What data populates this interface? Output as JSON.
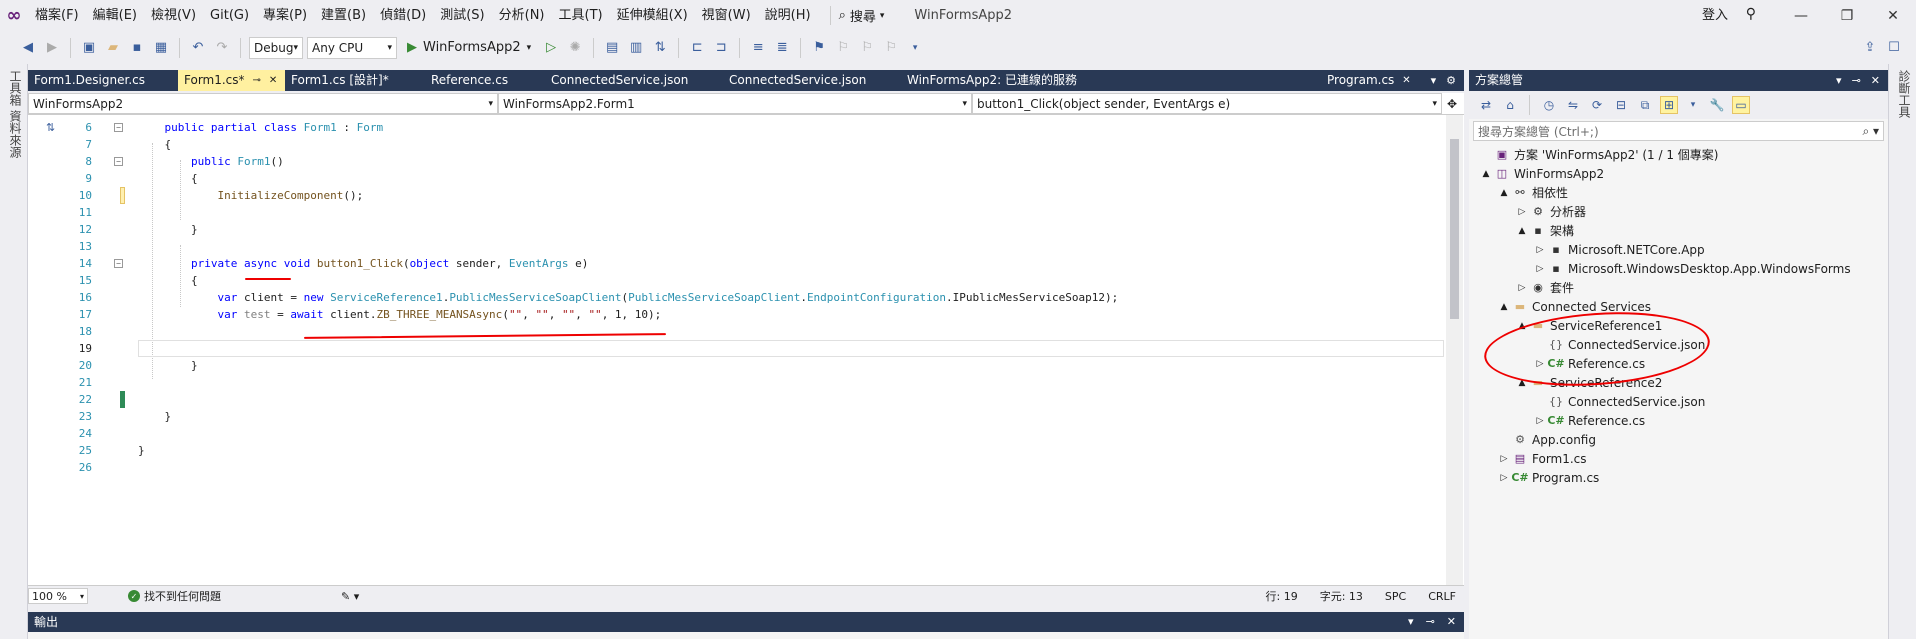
{
  "menu": {
    "items": [
      "檔案(F)",
      "編輯(E)",
      "檢視(V)",
      "Git(G)",
      "專案(P)",
      "建置(B)",
      "偵錯(D)",
      "測試(S)",
      "分析(N)",
      "工具(T)",
      "延伸模組(X)",
      "視窗(W)",
      "說明(H)"
    ],
    "search_label": "搜尋",
    "solution_name": "WinFormsApp2",
    "signin": "登入"
  },
  "toolbar": {
    "config": "Debug",
    "platform": "Any CPU",
    "run_label": "WinFormsApp2"
  },
  "left_strip": {
    "label": "工具箱  資料來源"
  },
  "right_strip": {
    "label": "診斷工具"
  },
  "tabs": [
    {
      "label": "Form1.Designer.cs",
      "active": false
    },
    {
      "label": "Form1.cs*",
      "active": true
    },
    {
      "label": "Form1.cs [設計]*",
      "active": false
    },
    {
      "label": "Reference.cs",
      "active": false
    },
    {
      "label": "ConnectedService.json",
      "active": false
    },
    {
      "label": "ConnectedService.json",
      "active": false
    },
    {
      "label": "WinFormsApp2: 已連線的服務",
      "active": false
    },
    {
      "label": "Program.cs",
      "active": false
    }
  ],
  "nav": {
    "project": "WinFormsApp2",
    "class": "WinFormsApp2.Form1",
    "member": "button1_Click(object sender, EventArgs e)"
  },
  "code": {
    "line_numbers": [
      "6",
      "7",
      "8",
      "9",
      "10",
      "11",
      "12",
      "13",
      "14",
      "15",
      "16",
      "17",
      "18",
      "19",
      "20",
      "21",
      "22",
      "23",
      "24",
      "25",
      "26"
    ]
  },
  "status": {
    "zoom": "100 %",
    "issues": "找不到任何問題",
    "line": "行: 19",
    "char": "字元: 13",
    "spc": "SPC",
    "crlf": "CRLF"
  },
  "output": {
    "title": "輸出"
  },
  "solution_explorer": {
    "title": "方案總管",
    "search_placeholder": "搜尋方案總管 (Ctrl+;)",
    "tree": [
      {
        "label": "方案 'WinFormsApp2' (1 / 1 個專案)",
        "level": 0,
        "expander": "",
        "icon": "solution-icon"
      },
      {
        "label": "WinFormsApp2",
        "level": 1,
        "expander": "▲",
        "icon": "project-icon"
      },
      {
        "label": "相依性",
        "level": 2,
        "expander": "▲",
        "icon": "dependencies-icon"
      },
      {
        "label": "分析器",
        "level": 3,
        "expander": "▷",
        "icon": "analyzer-icon"
      },
      {
        "label": "架構",
        "level": 3,
        "expander": "▲",
        "icon": "framework-icon"
      },
      {
        "label": "Microsoft.NETCore.App",
        "level": 4,
        "expander": "▷",
        "icon": "framework-icon"
      },
      {
        "label": "Microsoft.WindowsDesktop.App.WindowsForms",
        "level": 4,
        "expander": "▷",
        "icon": "framework-icon"
      },
      {
        "label": "套件",
        "level": 3,
        "expander": "▷",
        "icon": "package-icon"
      },
      {
        "label": "Connected Services",
        "level": 2,
        "expander": "▲",
        "icon": "folder-icon"
      },
      {
        "label": "ServiceReference1",
        "level": 3,
        "expander": "▲",
        "icon": "folder-icon"
      },
      {
        "label": "ConnectedService.json",
        "level": 4,
        "expander": "",
        "icon": "json-file-icon"
      },
      {
        "label": "Reference.cs",
        "level": 4,
        "expander": "▷",
        "icon": "csharp-file-icon"
      },
      {
        "label": "ServiceReference2",
        "level": 3,
        "expander": "▲",
        "icon": "folder-icon"
      },
      {
        "label": "ConnectedService.json",
        "level": 4,
        "expander": "",
        "icon": "json-file-icon"
      },
      {
        "label": "Reference.cs",
        "level": 4,
        "expander": "▷",
        "icon": "csharp-file-icon"
      },
      {
        "label": "App.config",
        "level": 2,
        "expander": "",
        "icon": "config-file-icon"
      },
      {
        "label": "Form1.cs",
        "level": 2,
        "expander": "▷",
        "icon": "form-file-icon"
      },
      {
        "label": "Program.cs",
        "level": 2,
        "expander": "▷",
        "icon": "csharp-file-icon"
      }
    ]
  },
  "colors": {
    "tab_bar": "#293955",
    "active_tab": "#fff0a0",
    "keyword": "#0000ff",
    "type": "#2b91af",
    "string": "#a31515",
    "annotation": "#ee0000"
  }
}
